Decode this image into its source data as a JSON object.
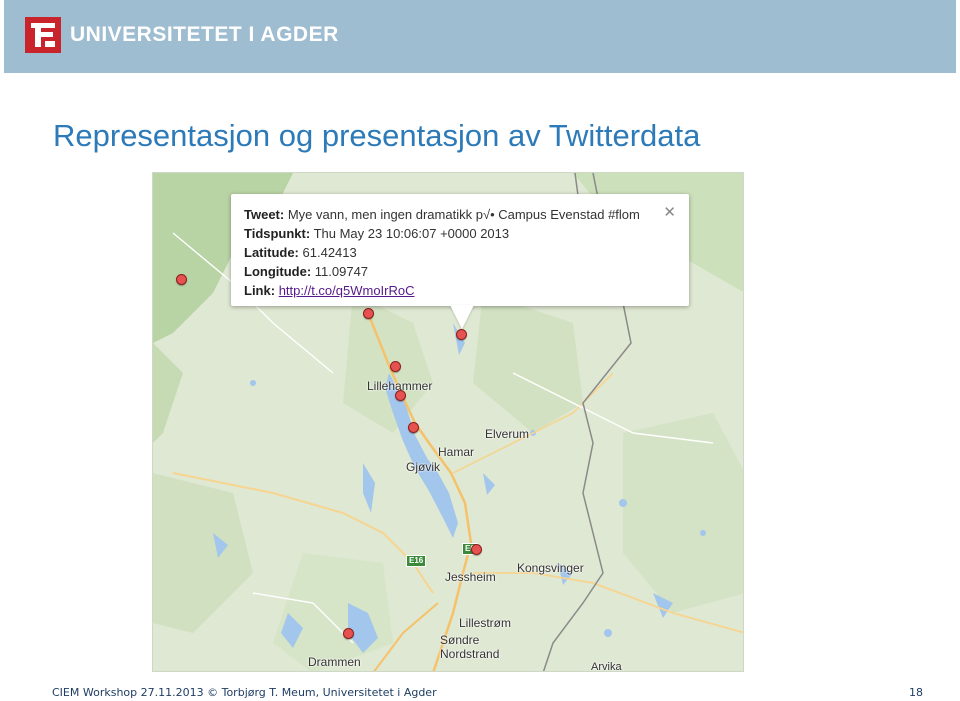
{
  "header": {
    "logo_icon": "uia-logo-icon",
    "university_name": "UNIVERSITETET I AGDER",
    "brand_color": "#9fbdd1",
    "logo_color": "#c9242b"
  },
  "slide": {
    "title": "Representasjon og presentasjon av Twitterdata",
    "title_color": "#2d7ab9"
  },
  "map": {
    "places": {
      "lillehammer": "Lillehammer",
      "elverum": "Elverum",
      "hamar": "Hamar",
      "gjovik": "Gjøvik",
      "jessheim": "Jessheim",
      "kongsvinger": "Kongsvinger",
      "lillestrom": "Lillestrøm",
      "sondre_nordstrand_1": "Søndre",
      "sondre_nordstrand_2": "Nordstrand",
      "drammen": "Drammen",
      "arvika": "Arvika"
    },
    "routes": {
      "e16": "E16",
      "e6": "E6"
    },
    "marker_color": "#e5524f",
    "popup": {
      "tweet_label": "Tweet:",
      "tweet_value": "Mye vann, men ingen dramatikk p√• Campus Evenstad #flom",
      "time_label": "Tidspunkt:",
      "time_value": "Thu May 23 10:06:07 +0000 2013",
      "lat_label": "Latitude:",
      "lat_value": "61.42413",
      "lon_label": "Longitude:",
      "lon_value": "11.09747",
      "link_label": "Link:",
      "link_value": "http://t.co/q5WmoIrRoC",
      "close_symbol": "✕"
    }
  },
  "footer": {
    "left_text": "CIEM Workshop 27.11.2013 © Torbjørg T. Meum, Universitetet i Agder",
    "page_number": "18"
  }
}
